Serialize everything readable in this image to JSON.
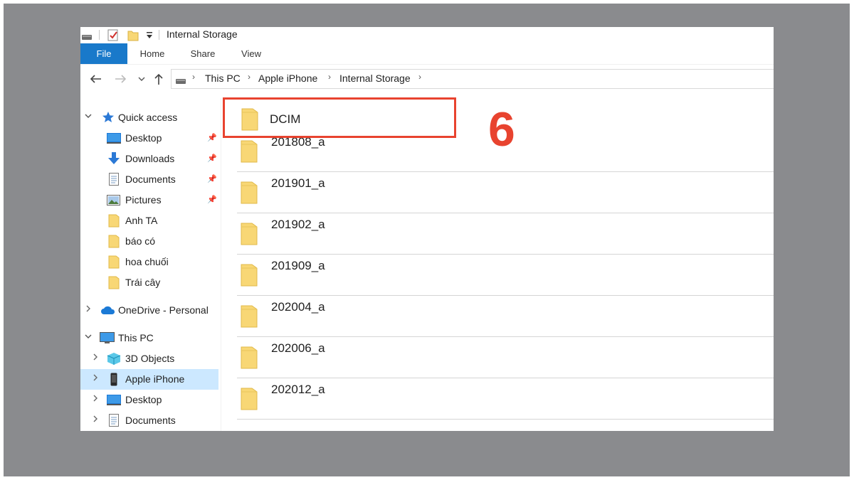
{
  "window": {
    "title": "Internal Storage"
  },
  "ribbon": {
    "tabs": [
      "File",
      "Home",
      "Share",
      "View"
    ]
  },
  "address": {
    "crumbs": [
      "This PC",
      "Apple iPhone",
      "Internal Storage"
    ]
  },
  "sidebar": {
    "quick_access": "Quick access",
    "quick_items": [
      {
        "label": "Desktop",
        "icon": "desktop-icon",
        "pinned": true
      },
      {
        "label": "Downloads",
        "icon": "download-arrow-icon",
        "pinned": true
      },
      {
        "label": "Documents",
        "icon": "documents-icon",
        "pinned": true
      },
      {
        "label": "Pictures",
        "icon": "pictures-icon",
        "pinned": true
      },
      {
        "label": "Anh TA",
        "icon": "folder-icon",
        "pinned": false
      },
      {
        "label": "báo có",
        "icon": "folder-icon",
        "pinned": false
      },
      {
        "label": "hoa chuối",
        "icon": "folder-icon",
        "pinned": false
      },
      {
        "label": "Trái cây",
        "icon": "folder-icon",
        "pinned": false
      }
    ],
    "onedrive": "OneDrive - Personal",
    "this_pc": "This PC",
    "pc_items": [
      {
        "label": "3D Objects",
        "icon": "3d-objects-icon"
      },
      {
        "label": "Apple iPhone",
        "icon": "iphone-icon",
        "selected": true
      },
      {
        "label": "Desktop",
        "icon": "desktop-icon"
      },
      {
        "label": "Documents",
        "icon": "documents-icon"
      }
    ]
  },
  "folders": [
    "DCIM",
    "201808_a",
    "201901_a",
    "201902_a",
    "201909_a",
    "202004_a",
    "202006_a",
    "202012_a"
  ],
  "annotation": {
    "step": "6"
  },
  "colors": {
    "accent": "#1979ca",
    "highlight": "#e8432f",
    "folder": "#f8d775",
    "selected": "#cce8ff",
    "frame": "#8a8b8e"
  }
}
